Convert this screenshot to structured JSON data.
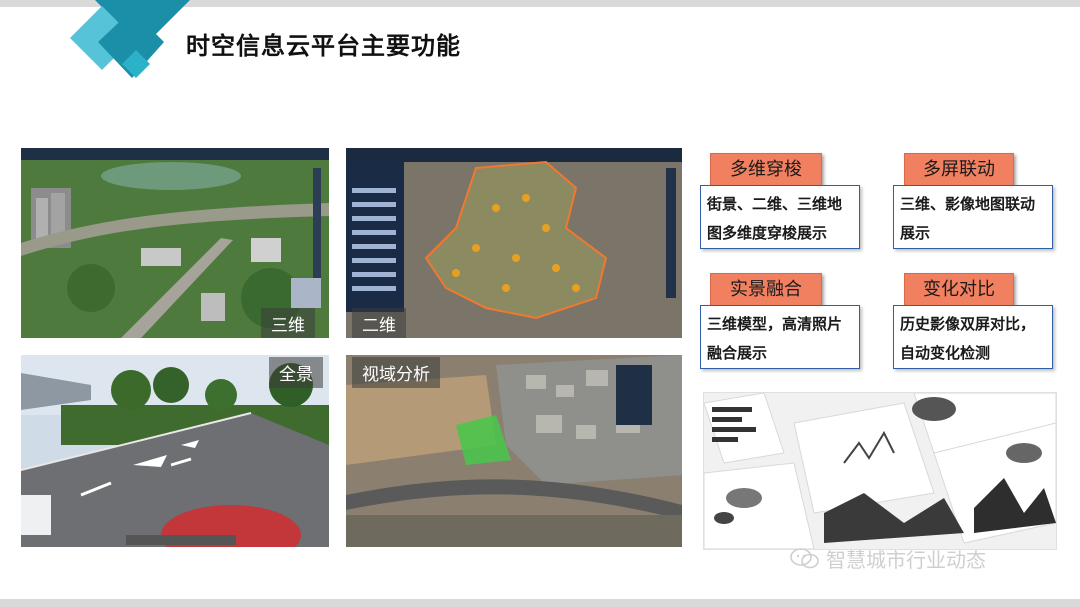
{
  "title": "时空信息云平台主要功能",
  "screenshots": [
    {
      "label": "三维"
    },
    {
      "label": "二维"
    },
    {
      "label": "全景"
    },
    {
      "label": "视域分析"
    }
  ],
  "functions": [
    {
      "tag": "多维穿梭",
      "desc_line1": "街景、二维、三维地",
      "desc_line2": "图多维度穿梭展示"
    },
    {
      "tag": "多屏联动",
      "desc_line1": "三维、影像地图联动",
      "desc_line2": "展示"
    },
    {
      "tag": "实景融合",
      "desc_line1": "三维模型，高清照片",
      "desc_line2": "融合展示"
    },
    {
      "tag": "变化对比",
      "desc_line1": "历史影像双屏对比，",
      "desc_line2": "自动变化检测"
    }
  ],
  "watermark": "智慧城市行业动态",
  "colors": {
    "accent_teal": "#1aa0b8",
    "tag_orange": "#f08060",
    "box_border": "#2f5fa8"
  }
}
